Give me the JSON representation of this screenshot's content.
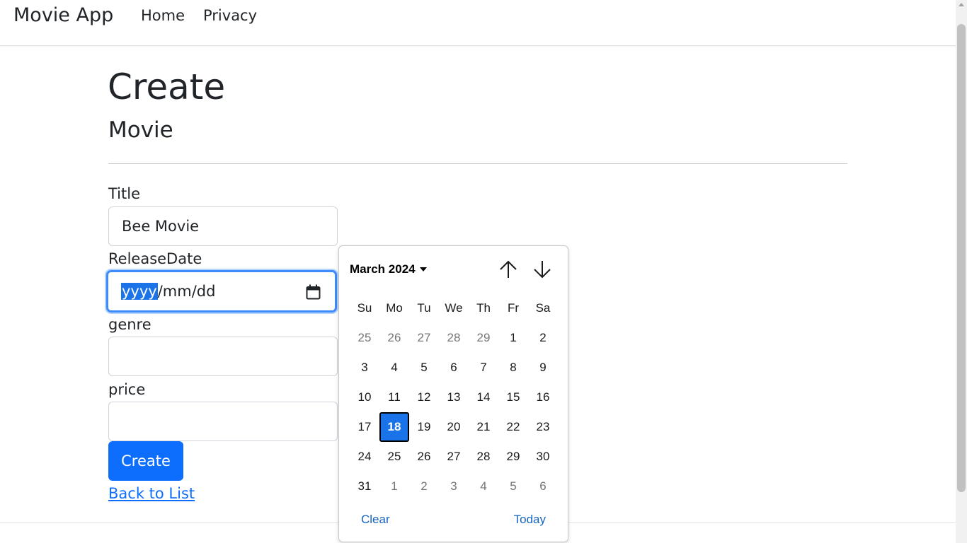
{
  "navbar": {
    "brand": "Movie App",
    "links": [
      "Home",
      "Privacy"
    ]
  },
  "page": {
    "title": "Create",
    "subtitle": "Movie"
  },
  "form": {
    "title_label": "Title",
    "title_value": "Bee Movie",
    "release_label": "ReleaseDate",
    "release_placeholder": {
      "year": "yyyy",
      "rest": "/mm/dd"
    },
    "genre_label": "genre",
    "genre_value": "",
    "price_label": "price",
    "price_value": "",
    "submit_label": "Create",
    "back_link": "Back to List"
  },
  "datepicker": {
    "month_label": "March 2024",
    "weekdays": [
      "Su",
      "Mo",
      "Tu",
      "We",
      "Th",
      "Fr",
      "Sa"
    ],
    "weeks": [
      [
        "25",
        "26",
        "27",
        "28",
        "29",
        "1",
        "2"
      ],
      [
        "3",
        "4",
        "5",
        "6",
        "7",
        "8",
        "9"
      ],
      [
        "10",
        "11",
        "12",
        "13",
        "14",
        "15",
        "16"
      ],
      [
        "17",
        "18",
        "19",
        "20",
        "21",
        "22",
        "23"
      ],
      [
        "24",
        "25",
        "26",
        "27",
        "28",
        "29",
        "30"
      ],
      [
        "31",
        "1",
        "2",
        "3",
        "4",
        "5",
        "6"
      ]
    ],
    "selected_day": "18",
    "clear_label": "Clear",
    "today_label": "Today"
  },
  "colors": {
    "accent": "#0d6efd",
    "selected_day_bg": "#1a73e8"
  }
}
